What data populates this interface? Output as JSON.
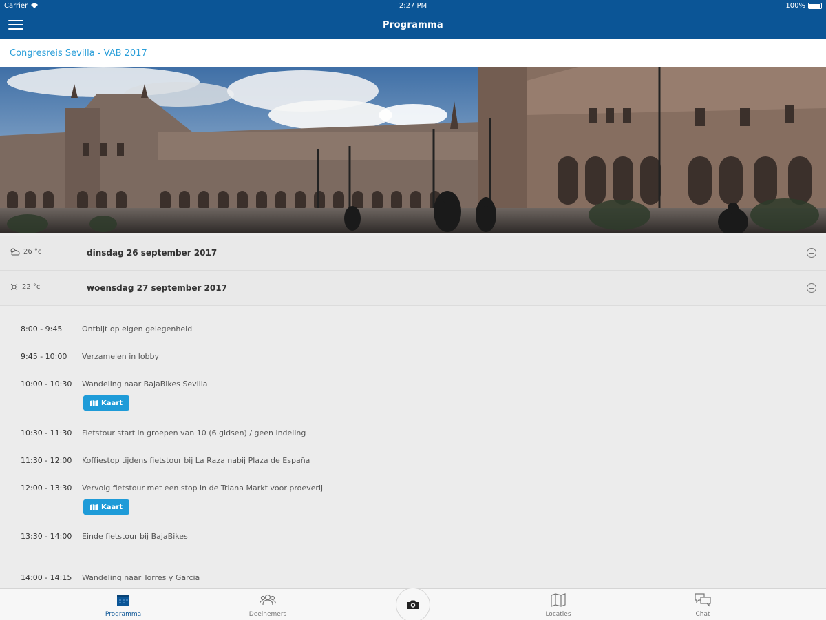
{
  "status_bar": {
    "carrier": "Carrier",
    "time": "2:27 PM",
    "battery": "100%"
  },
  "nav": {
    "title": "Programma"
  },
  "subheader": {
    "title": "Congresreis Sevilla - VAB 2017"
  },
  "days": [
    {
      "temp": "26 °c",
      "weather_icon": "cloud-sun-icon",
      "date": "dinsdag 26 september 2017",
      "expanded": false
    },
    {
      "temp": "22 °c",
      "weather_icon": "sun-icon",
      "date": "woensdag 27 september 2017",
      "expanded": true
    }
  ],
  "program": [
    {
      "time": "8:00 - 9:45",
      "description": "Ontbijt op eigen gelegenheid"
    },
    {
      "time": "9:45 - 10:00",
      "description": "Verzamelen in lobby"
    },
    {
      "time": "10:00 - 10:30",
      "description": "Wandeling naar BajaBikes Sevilla",
      "button": "Kaart"
    },
    {
      "time": "10:30 - 11:30",
      "description": "Fietstour start in groepen van 10 (6 gidsen) / geen indeling"
    },
    {
      "time": "11:30 - 12:00",
      "description": "Koffiestop tijdens fietstour bij La Raza nabij Plaza de España"
    },
    {
      "time": "12:00 - 13:30",
      "description": "Vervolg fietstour met een stop in de Triana Markt voor proeverij",
      "button": "Kaart"
    },
    {
      "time": "13:30 - 14:00",
      "description": "Einde fietstour bij BajaBikes"
    },
    {
      "time": "14:00 - 14:15",
      "description": "Wandeling naar Torres y Garcia"
    }
  ],
  "tabs": [
    {
      "label": "Programma",
      "icon": "calendar-icon",
      "active": true
    },
    {
      "label": "Deelnemers",
      "icon": "people-icon",
      "active": false
    },
    {
      "label": "",
      "icon": "camera-icon",
      "active": false
    },
    {
      "label": "Locaties",
      "icon": "map-icon",
      "active": false
    },
    {
      "label": "Chat",
      "icon": "chat-icon",
      "active": false
    }
  ],
  "colors": {
    "primary": "#0b5596",
    "accent": "#1e9bd8",
    "link": "#2b9fd9",
    "background": "#ececec"
  }
}
